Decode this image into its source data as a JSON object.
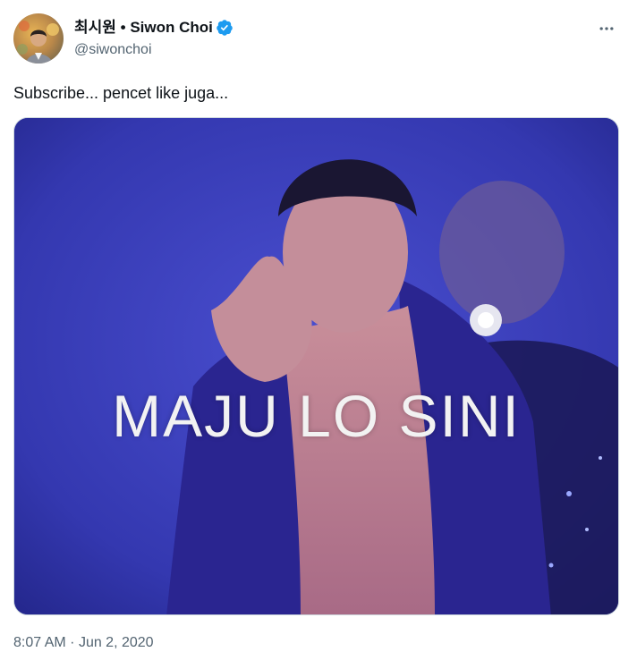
{
  "author": {
    "display_name": "최시원 • Siwon Choi",
    "handle": "@siwonchoi",
    "avatar_icon": "profile-photo",
    "verified_icon": "verified-badge-icon",
    "verified_color": "#1d9bf0"
  },
  "tweet": {
    "text": "Subscribe... pencet like juga...",
    "media_caption": "MAJU LO SINI",
    "time": "8:07 AM",
    "separator": "·",
    "date": "Jun 2, 2020"
  },
  "actions": {
    "more_icon": "more-horizontal-icon"
  },
  "colors": {
    "text_primary": "#0f1419",
    "text_secondary": "#536471",
    "media_background": "#3a3cb8"
  }
}
